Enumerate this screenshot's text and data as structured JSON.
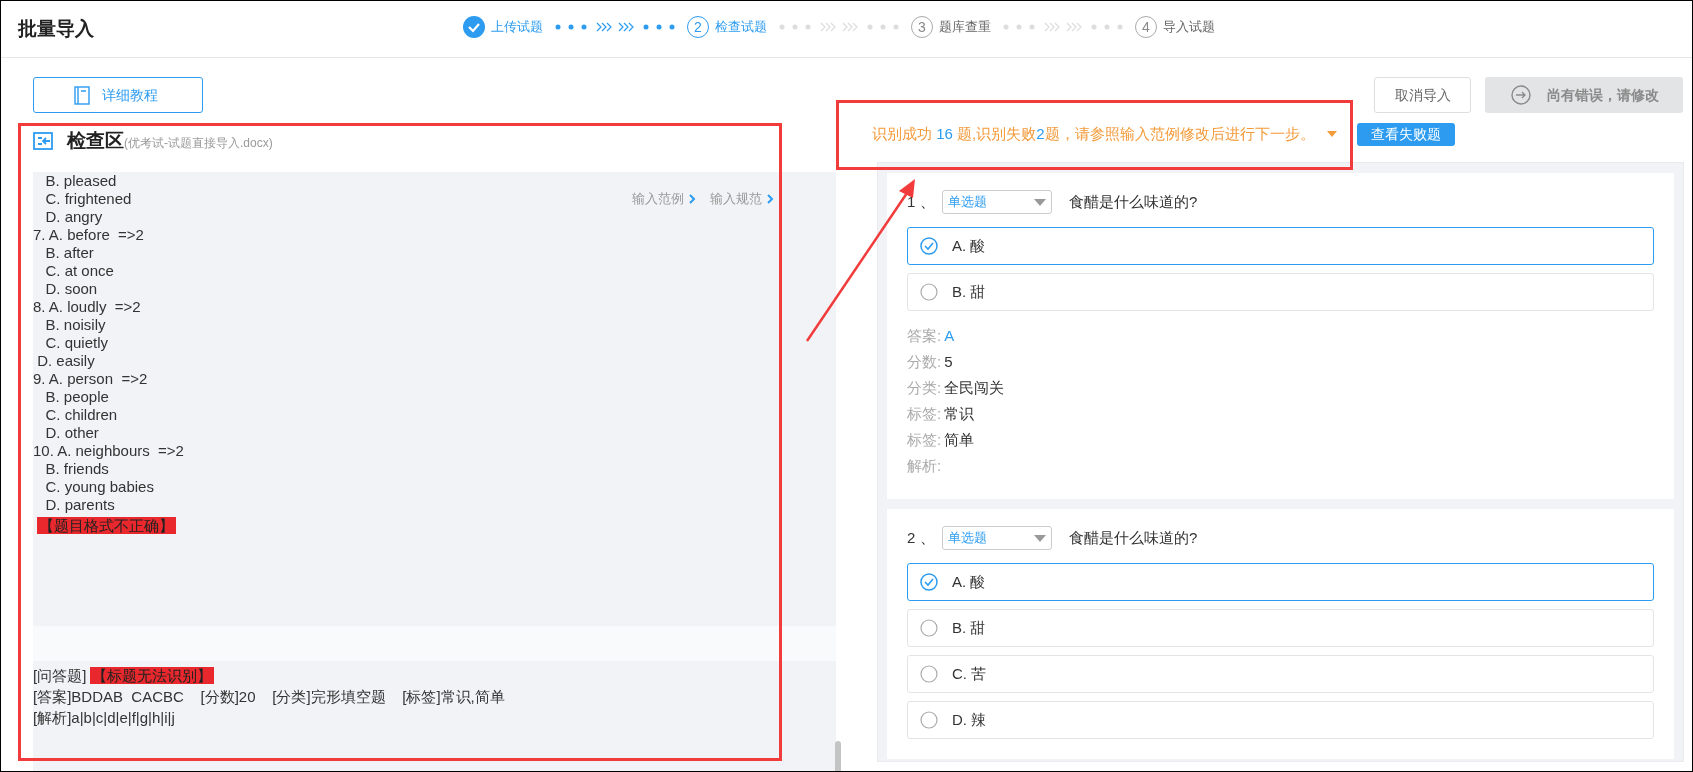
{
  "header": {
    "title": "批量导入"
  },
  "steps": [
    {
      "label": "上传试题",
      "completed": true,
      "selected": false
    },
    {
      "number": "2",
      "label": "检查试题",
      "completed": false,
      "selected": true
    },
    {
      "number": "3",
      "label": "题库查重",
      "completed": false,
      "selected": false
    },
    {
      "number": "4",
      "label": "导入试题",
      "completed": false,
      "selected": false
    }
  ],
  "tutorial_button": "详细教程",
  "check_area": {
    "title": "检查区",
    "file": "(优考试-试题直接导入.docx)",
    "links": [
      "输入范例",
      "输入规范"
    ],
    "lines": [
      "   B. pleased",
      "   C. frightened",
      "   D. angry",
      "7. A. before  =>2",
      "   B. after",
      "   C. at once",
      "   D. soon",
      "8. A. loudly  =>2",
      "   B. noisily",
      "   C. quietly",
      " D. easily",
      "9. A. person  =>2",
      "   B. people",
      "   C. children",
      "   D. other",
      "10. A. neighbours  =>2",
      "   B. friends",
      "   C. young babies",
      "   D. parents"
    ],
    "error_tag": "【题目格式不正确】",
    "next_block": {
      "type_label": "[问答题]",
      "error_tag": "【标题无法识别】",
      "lines": [
        "[答案]BDDAB  CACBC    [分数]20    [分类]完形填空题    [标签]常识,简单",
        "[解析]a|b|c|d|e|f|g|h|i|j"
      ]
    }
  },
  "actions": {
    "cancel": "取消导入",
    "next": {
      "label": "尚有错误，请修改",
      "disabled": true
    }
  },
  "message": {
    "parts": [
      {
        "text": "识别成功 ",
        "highlight": false
      },
      {
        "text": "16",
        "highlight": true
      },
      {
        "text": " 题,识别失败",
        "highlight": false
      },
      {
        "text": "2",
        "highlight": true
      },
      {
        "text": "题，请参照输入范例修改后进行下一步。",
        "highlight": false
      }
    ],
    "button": "查看失败题"
  },
  "questions": [
    {
      "number": "1 、",
      "type": "单选题",
      "text": "食醋是什么味道的?",
      "options": [
        {
          "label": "A. 酸",
          "selected": true
        },
        {
          "label": "B. 甜",
          "selected": false
        }
      ],
      "details": [
        {
          "label": "答案:",
          "value": "A",
          "kind": "answer"
        },
        {
          "label": "分数:",
          "value": "5",
          "kind": "plain"
        },
        {
          "label": "分类:",
          "value": "全民闯关",
          "kind": "plain"
        },
        {
          "label": "标签:",
          "value": "常识",
          "kind": "plain"
        },
        {
          "label": "标签:",
          "value": "简单",
          "kind": "plain"
        },
        {
          "label": "解析:"
        }
      ]
    },
    {
      "number": "2 、",
      "type": "单选题",
      "text": "食醋是什么味道的?",
      "options": [
        {
          "label": "A. 酸",
          "selected": true
        },
        {
          "label": "B. 甜",
          "selected": false
        },
        {
          "label": "C. 苦",
          "selected": false
        },
        {
          "label": "D. 辣",
          "selected": false
        }
      ]
    }
  ]
}
